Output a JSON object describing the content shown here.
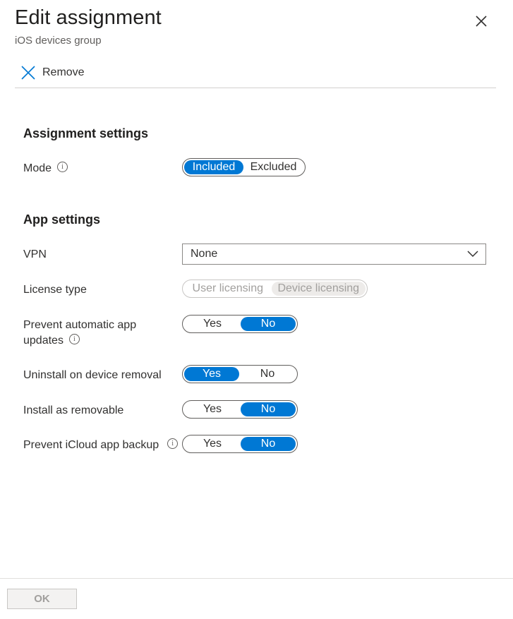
{
  "header": {
    "title": "Edit assignment",
    "subtitle": "iOS devices group"
  },
  "toolbar": {
    "remove_label": "Remove"
  },
  "assignment_settings": {
    "heading": "Assignment settings",
    "mode": {
      "label": "Mode",
      "options": [
        "Included",
        "Excluded"
      ],
      "selected": "Included"
    }
  },
  "app_settings": {
    "heading": "App settings",
    "vpn": {
      "label": "VPN",
      "value": "None"
    },
    "license_type": {
      "label": "License type",
      "options": [
        "User licensing",
        "Device licensing"
      ],
      "selected": "Device licensing",
      "disabled": true
    },
    "prevent_auto_updates": {
      "label_line1": "Prevent automatic app",
      "label_line2": "updates",
      "options": [
        "Yes",
        "No"
      ],
      "selected": "No"
    },
    "uninstall_on_removal": {
      "label": "Uninstall on device removal",
      "options": [
        "Yes",
        "No"
      ],
      "selected": "Yes"
    },
    "install_as_removable": {
      "label": "Install as removable",
      "options": [
        "Yes",
        "No"
      ],
      "selected": "No"
    },
    "prevent_icloud_backup": {
      "label": "Prevent iCloud app backup",
      "options": [
        "Yes",
        "No"
      ],
      "selected": "No"
    }
  },
  "footer": {
    "ok_label": "OK"
  },
  "colors": {
    "accent": "#0078d4",
    "text": "#323130",
    "disabled": "#a19f9d"
  },
  "icons": {
    "close": "close-icon",
    "remove": "remove-x-icon",
    "info": "info-icon",
    "dropdown": "chevron-down-icon"
  }
}
